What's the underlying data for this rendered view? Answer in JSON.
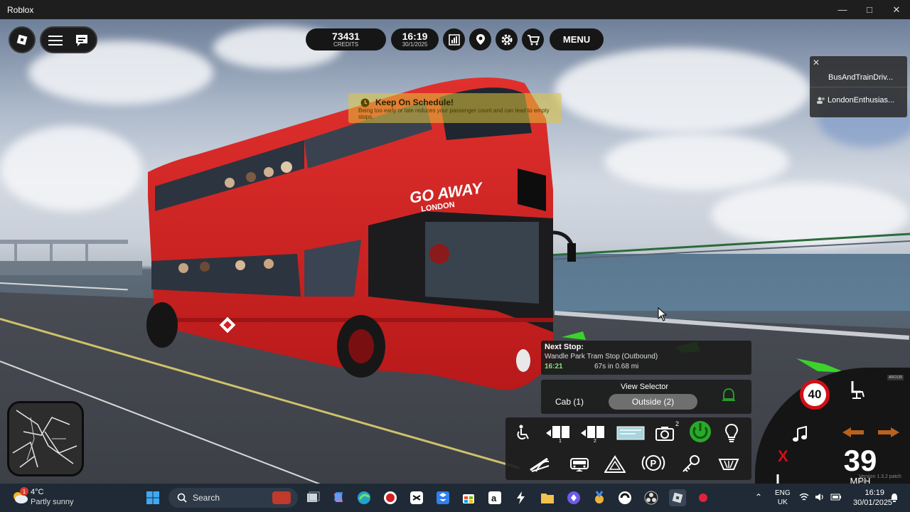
{
  "window": {
    "title": "Roblox",
    "controls": [
      "minimize",
      "maximize",
      "close"
    ]
  },
  "hud": {
    "credits_value": "73431",
    "credits_label": "CREDITS",
    "time": "16:19",
    "date": "30/1/2025",
    "menu_label": "MENU"
  },
  "notification": {
    "title": "Keep On Schedule!",
    "body": "Being too early or late reduces your passenger count and can lead to empty stops."
  },
  "players": {
    "items": [
      "BusAndTrainDriv...",
      "LondonEnthusias..."
    ]
  },
  "bus": {
    "livery_title": "GO AWAY",
    "livery_sub": "LONDON"
  },
  "next_stop": {
    "label": "Next Stop:",
    "name": "Wandle Park Tram Stop (Outbound)",
    "arrival": "16:21",
    "eta": "67s in 0.68 mi"
  },
  "view_selector": {
    "title": "View Selector",
    "options": [
      "Cab (1)",
      "Outside (2)"
    ],
    "selected": "Outside (2)"
  },
  "controls": {
    "camera_badge": "2",
    "row1": [
      "wheelchair-icon",
      "door-1-icon",
      "door-2-icon",
      "destination-display-icon",
      "camera-icon",
      "power-icon",
      "light-bulb-icon"
    ],
    "row2": [
      "wiper-icon",
      "bus-front-icon",
      "hazard-icon",
      "parking-brake-icon",
      "key-icon",
      "fan-icon"
    ],
    "door1_num": "1",
    "door2_num": "2",
    "parking_label": "P"
  },
  "speedo": {
    "speed_limit": "40",
    "speed": "39",
    "unit": "MPH",
    "x_mark": "X",
    "version": "Version 1.3.2 patch 163",
    "small_badge": "ARO135"
  },
  "taskbar": {
    "weather_temp": "4°C",
    "weather_desc": "Partly sunny",
    "weather_badge": "1",
    "search_placeholder": "Search",
    "lang_top": "ENG",
    "lang_bottom": "UK",
    "clock_time": "16:19",
    "clock_date": "30/01/2025"
  },
  "colors": {
    "bus_red": "#d8201f",
    "hud_dark": "#161616",
    "accent_green": "#3cd22b",
    "speed_limit_red": "#d10f16",
    "indicator_orange": "#b8621f"
  }
}
